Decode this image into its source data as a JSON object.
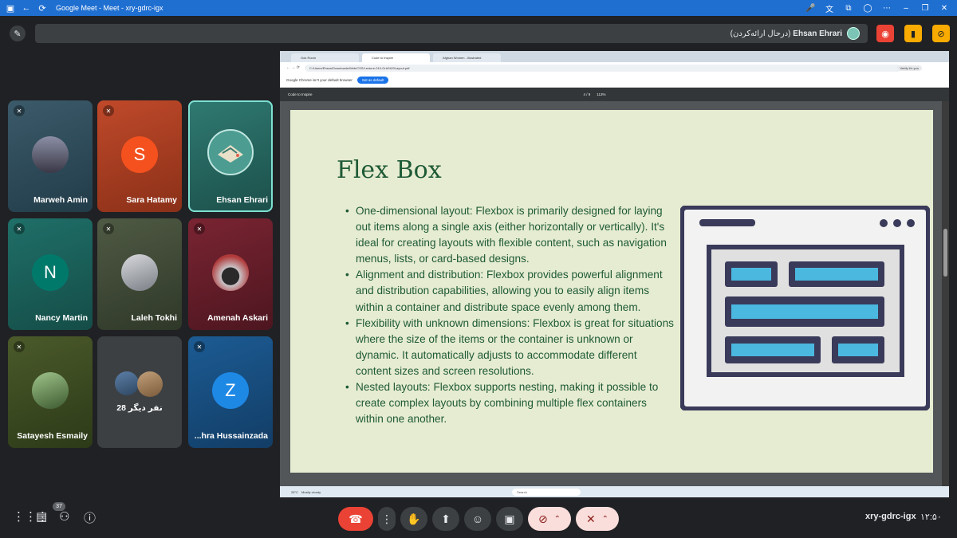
{
  "window": {
    "title": "Google Meet - Meet - xry-gdrc-igx"
  },
  "presenter": {
    "name": "Ehsan Ehrari",
    "status": "(درحال ارائه‌کردن)"
  },
  "participants": [
    {
      "name": "Marweh Amin"
    },
    {
      "name": "Sara Hatamy",
      "initial": "S"
    },
    {
      "name": "Ehsan Ehrari"
    },
    {
      "name": "Nancy Martin",
      "initial": "N"
    },
    {
      "name": "Laleh Tokhi"
    },
    {
      "name": "Amenah Askari"
    },
    {
      "name": "Satayesh Esmaily"
    },
    {
      "name": "28 نفر دیگر"
    },
    {
      "name": "...hra Hussainzada",
      "initial": "Z"
    }
  ],
  "browser": {
    "tabs": [
      "Gok Room",
      "Code to Inspire",
      "Afghan Women - Illustrated"
    ],
    "url": "C:/Users/Ehsan/Downloads/Web/CSS/Lecture-010-Grid%20Layout.pdf",
    "profile": "Verify it's you",
    "notice": "Google Chrome isn't your default browser",
    "notice_button": "Set as default"
  },
  "pdf": {
    "title": "Code to Inspire",
    "page": "4 / 9",
    "zoom": "113%"
  },
  "slide": {
    "heading": "Flex Box",
    "bullets": [
      "One-dimensional layout: Flexbox is primarily designed for laying out items along a single axis (either horizontally or vertically). It's ideal for creating layouts with flexible content, such as navigation menus, lists, or card-based designs.",
      "Alignment and distribution: Flexbox provides powerful alignment and distribution capabilities, allowing you to easily align items within a container and distribute space evenly among them.",
      "Flexibility with unknown dimensions: Flexbox is great for situations where the size of the items or the container is unknown or dynamic. It automatically adjusts to accommodate different content sizes and screen resolutions.",
      "Nested layouts: Flexbox supports nesting, making it possible to create complex layouts by combining multiple flex containers within one another."
    ]
  },
  "taskbar": {
    "search": "Search",
    "weather": "28°C",
    "weather_sub": "Mostly cloudy"
  },
  "meeting": {
    "code": "xry-gdrc-igx",
    "time": "۱۲:۵۰",
    "participants_count": "37"
  },
  "colors": {
    "leave": "#ea4335",
    "active_tile": "#7ee0d2",
    "slide_text": "#1e5a36",
    "slide_bg": "#e6ecd1"
  }
}
